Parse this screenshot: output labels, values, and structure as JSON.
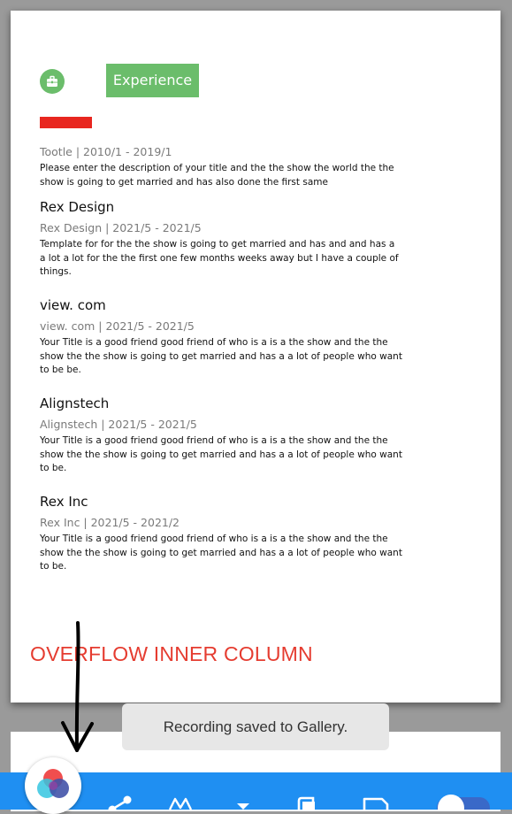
{
  "resume": {
    "section_title": "Experience",
    "section_icon": "briefcase-icon",
    "entries": [
      {
        "title": "",
        "meta": "Tootle | 2010/1 - 2019/1",
        "description": "Please enter the description of your title and the the show the world the the show is going to get married and has also done the first same"
      },
      {
        "title": "Rex Design",
        "meta": "Rex Design | 2021/5 - 2021/5",
        "description": "Template for for the the show is going to get married and has and and has a a lot a lot for the the first one few months weeks away but I have a couple of things."
      },
      {
        "title": "view. com",
        "meta": "view. com  | 2021/5 - 2021/5",
        "description": "Your Title is a good friend good friend of who is a is a the show and the the show the the show is going to get married and has a a lot of people who want to be be."
      },
      {
        "title": "Alignstech",
        "meta": "Alignstech | 2021/5 - 2021/5",
        "description": "Your Title is a good friend good friend of who is a is a the show and the the show the the show is going to get married and has a a lot of people who want to be."
      },
      {
        "title": "Rex Inc",
        "meta": "Rex Inc | 2021/5 - 2021/2",
        "description": "Your Title is a good friend good friend of who is a is a the show and the the show the the show is going to get married and has a a lot of people who want to be."
      }
    ]
  },
  "annotation": {
    "label": "OVERFLOW INNER COLUMN"
  },
  "toast": {
    "message": "Recording saved to Gallery."
  },
  "toolbar": {
    "icons": [
      "share-icon",
      "font-icon",
      "dropdown-icon",
      "copy-icon",
      "document-icon",
      "toggle-icon"
    ]
  },
  "colors": {
    "accent_green": "#6bbd6b",
    "redaction_red": "#e8261f",
    "annotation_red": "#e53c30",
    "toolbar_blue": "#1f8ff2",
    "page_gray": "#9a9a9a"
  }
}
